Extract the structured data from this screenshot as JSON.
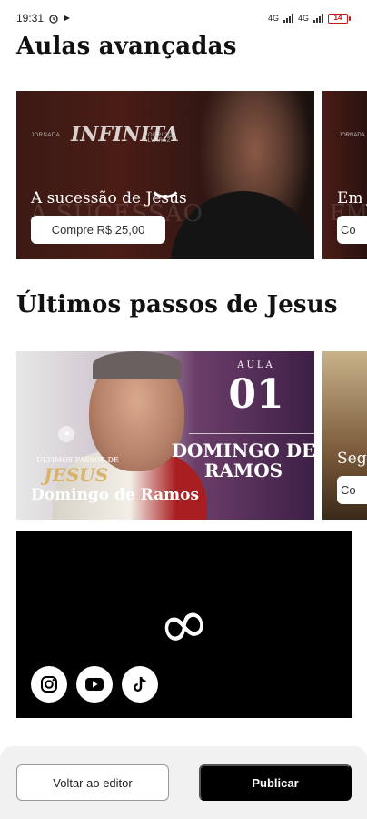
{
  "status_bar": {
    "time": "19:31",
    "battery": "14",
    "network_1": "4G",
    "network_2": "4G"
  },
  "sections": {
    "advanced": {
      "title": "Aulas avançadas",
      "card_1": {
        "brand": "INFINITA",
        "brand_left": "JORNADA",
        "brand_right": "RODRIGO ALVAREZ",
        "ghost_text": "A SUCESSÃO",
        "label": "A sucessão de Jesus",
        "buy_label": "Compre R$ 25,00"
      },
      "card_2": {
        "brand_left": "JORNADA",
        "label": "Em J",
        "ghost_text": "EM",
        "buy_label": "Co"
      }
    },
    "last_steps": {
      "title": "Últimos passos de Jesus",
      "card_1": {
        "aula": "AULA",
        "aula_number": "01",
        "big_title": "DOMINGO DE RAMOS",
        "kicker": "ÚLTIMOS PASSOS DE",
        "script": "JESUS",
        "label": "Domingo de Ramos"
      },
      "card_2": {
        "label": "Segu",
        "buy_label": "Co"
      }
    }
  },
  "social": {
    "logo": "∞",
    "icons": [
      "instagram-icon",
      "youtube-icon",
      "tiktok-icon"
    ]
  },
  "footer": {
    "back_label": "Voltar ao editor",
    "publish_label": "Publicar"
  },
  "colors": {
    "primary": "#000000",
    "background": "#ffffff",
    "battery_low": "#c21818"
  }
}
